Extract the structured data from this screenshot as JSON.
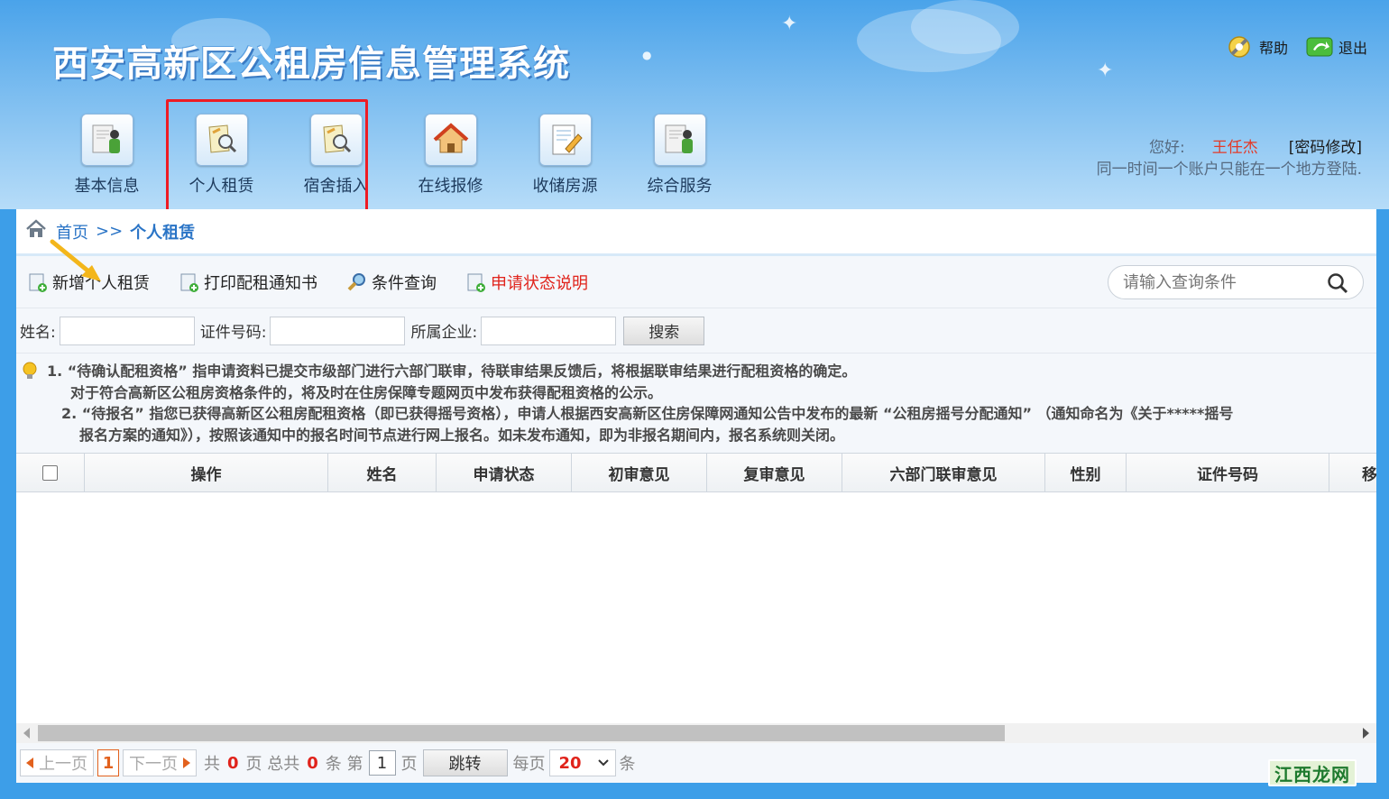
{
  "header": {
    "title": "西安高新区公租房信息管理系统",
    "help_label": "帮助",
    "logout_label": "退出"
  },
  "nav": {
    "items": [
      {
        "label": "基本信息",
        "icon": "person-doc-icon"
      },
      {
        "label": "个人租赁",
        "icon": "search-doc-icon"
      },
      {
        "label": "宿舍插入",
        "icon": "search-doc-icon"
      },
      {
        "label": "在线报修",
        "icon": "house-icon"
      },
      {
        "label": "收储房源",
        "icon": "edit-doc-icon"
      },
      {
        "label": "综合服务",
        "icon": "person-doc-icon"
      }
    ]
  },
  "user": {
    "greeting": "您好:",
    "name": "王任杰",
    "change_password": "[密码修改]",
    "notice": "同一时间一个账户只能在一个地方登陆."
  },
  "breadcrumb": {
    "home": "首页",
    "separator": ">>",
    "current": "个人租赁"
  },
  "toolbar": {
    "add": "新增个人租赁",
    "print": "打印配租通知书",
    "query": "条件查询",
    "status_desc": "申请状态说明",
    "search_placeholder": "请输入查询条件"
  },
  "filters": {
    "name_label": "姓名:",
    "id_label": "证件号码:",
    "company_label": "所属企业:",
    "search_button": "搜索"
  },
  "notes": {
    "line1": "1. “待确认配租资格” 指申请资料已提交市级部门进行六部门联审，待联审结果反馈后，将根据联审结果进行配租资格的确定。",
    "line2": "对于符合高新区公租房资格条件的，将及时在住房保障专题网页中发布获得配租资格的公示。",
    "line3": "2. “待报名” 指您已获得高新区公租房配租资格（即已获得摇号资格），申请人根据西安高新区住房保障网通知公告中发布的最新 “公租房摇号分配通知” （通知命名为《关于*****摇号",
    "line4": "报名方案的通知》），按照该通知中的报名时间节点进行网上报名。如未发布通知，即为非报名期间内，报名系统则关闭。"
  },
  "table": {
    "columns": [
      "操作",
      "姓名",
      "申请状态",
      "初审意见",
      "复审意见",
      "六部门联审意见",
      "性别",
      "证件号码",
      "移"
    ],
    "rows": []
  },
  "pager": {
    "prev": "上一页",
    "current_page": "1",
    "next": "下一页",
    "total_prefix": "共",
    "total_pages": "0",
    "pages_suffix": "页 总共",
    "total_records": "0",
    "records_suffix": "条 第",
    "page_input": "1",
    "page_suffix": "页",
    "jump": "跳转",
    "per_page_label": "每页",
    "per_page": "20",
    "per_page_suffix": "条"
  },
  "watermark": "江西龙网",
  "colors": {
    "highlight_box": "#ee1b24",
    "accent_blue": "#2a74c6",
    "status_red": "#e0231b",
    "pager_orange": "#e2611d"
  }
}
